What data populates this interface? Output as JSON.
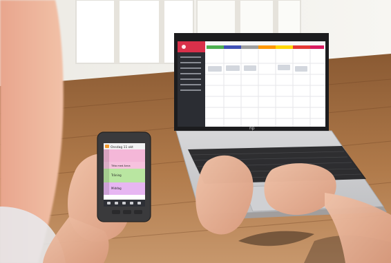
{
  "photo": {
    "subject": "photo-of-person-using-phone-and-laptop",
    "laptop_brand_mark": "hp",
    "colors": {
      "wall": "#f1efe9",
      "table": "#b07a4a",
      "laptop_bezel": "#1c1c1e",
      "laptop_body": "#d9d9db",
      "screen_bg": "#ffffff",
      "sidebar": "#2b2d33",
      "accent_red": "#d9304a",
      "phone_body": "#3a3a3c"
    }
  },
  "phone": {
    "header_text": "Onsdag 11 okt",
    "events": [
      {
        "label": "",
        "color": "#f4b7d8"
      },
      {
        "label": "Titta med Anna",
        "color": "#f4b7d8"
      },
      {
        "label": "Träning",
        "color": "#b9e6a1"
      },
      {
        "label": "Middag",
        "color": "#e7b6f2"
      }
    ]
  }
}
